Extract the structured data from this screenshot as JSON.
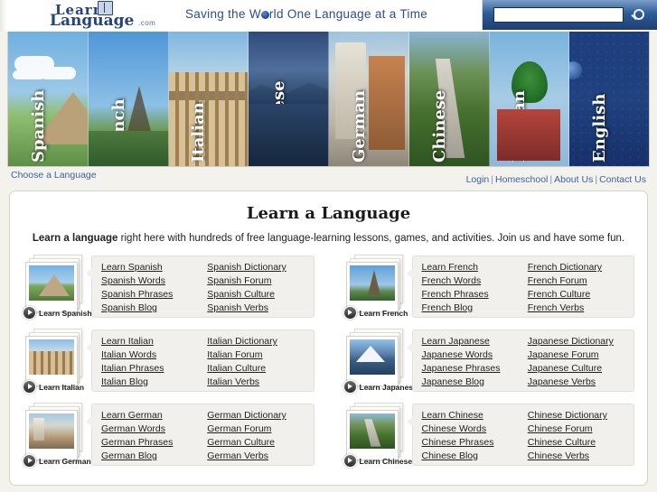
{
  "header": {
    "logo": {
      "line1": "Learn",
      "line2": "Language",
      "suffix": ".com",
      "book_icon": "book-icon"
    },
    "tagline_before": "Saving the W",
    "tagline_after": "rld One Language at a Time",
    "search": {
      "value": "",
      "placeholder": "",
      "icon": "search-icon"
    }
  },
  "banner": {
    "languages": [
      {
        "name": "Spanish",
        "scene": "chichen-itza-pyramid"
      },
      {
        "name": "French",
        "scene": "eiffel-tower-park"
      },
      {
        "name": "Italian",
        "scene": "colosseum"
      },
      {
        "name": "Japanese",
        "scene": "mount-fuji-lake"
      },
      {
        "name": "German",
        "scene": "german-village-street"
      },
      {
        "name": "Chinese",
        "scene": "great-wall"
      },
      {
        "name": "Russian",
        "scene": "saint-basils-cathedral"
      },
      {
        "name": "English",
        "scene": "blue-globe-panel"
      }
    ]
  },
  "subbar": {
    "choose_language": "Choose a Language",
    "topnav": [
      "Login",
      "Homeschool",
      "About Us",
      "Contact Us"
    ],
    "separator": "|"
  },
  "main": {
    "title": "Learn a Language",
    "intro_bold": "Learn a language",
    "intro_rest": " right here with hundreds of free language-learning lessons, games, and activities. Join us and have some fun.",
    "blocks": [
      {
        "language": "Spanish",
        "play_label": "Learn Spanish",
        "thumb": "chichen-itza-thumbnail",
        "links_left": [
          "Learn Spanish",
          "Spanish Words",
          "Spanish Phrases",
          "Spanish Blog"
        ],
        "links_right": [
          "Spanish Dictionary",
          "Spanish Forum",
          "Spanish Culture",
          "Spanish Verbs"
        ]
      },
      {
        "language": "French",
        "play_label": "Learn French",
        "thumb": "eiffel-tower-thumbnail",
        "links_left": [
          "Learn French",
          "French Words",
          "French Phrases",
          "French Blog"
        ],
        "links_right": [
          "French Dictionary",
          "French Forum",
          "French Culture",
          "French Verbs"
        ]
      },
      {
        "language": "Italian",
        "play_label": "Learn Italian",
        "thumb": "colosseum-thumbnail",
        "links_left": [
          "Learn Italian",
          "Italian Words",
          "Italian Phrases",
          "Italian Blog"
        ],
        "links_right": [
          "Italian Dictionary",
          "Italian Forum",
          "Italian Culture",
          "Italian Verbs"
        ]
      },
      {
        "language": "Japanese",
        "play_label": "Learn Japanese",
        "thumb": "mount-fuji-thumbnail",
        "links_left": [
          "Learn Japanese",
          "Japanese Words",
          "Japanese Phrases",
          "Japanese Blog"
        ],
        "links_right": [
          "Japanese Dictionary",
          "Japanese Forum",
          "Japanese Culture",
          "Japanese Verbs"
        ]
      },
      {
        "language": "German",
        "play_label": "Learn German",
        "thumb": "german-town-thumbnail",
        "links_left": [
          "Learn German",
          "German Words",
          "German Phrases",
          "German Blog"
        ],
        "links_right": [
          "German Dictionary",
          "German Forum",
          "German Culture",
          "German Verbs"
        ]
      },
      {
        "language": "Chinese",
        "play_label": "Learn Chinese",
        "thumb": "great-wall-thumbnail",
        "links_left": [
          "Learn Chinese",
          "Chinese Words",
          "Chinese Phrases",
          "Chinese Blog"
        ],
        "links_right": [
          "Chinese Dictionary",
          "Chinese Forum",
          "Chinese Culture",
          "Chinese Verbs"
        ]
      }
    ]
  },
  "colors": {
    "brand_blue": "#23447e",
    "link_blue": "#3c63a0",
    "page_background": "#f3f2ec",
    "card_background": "#ffffff",
    "panel_background": "#f1f0ec"
  }
}
